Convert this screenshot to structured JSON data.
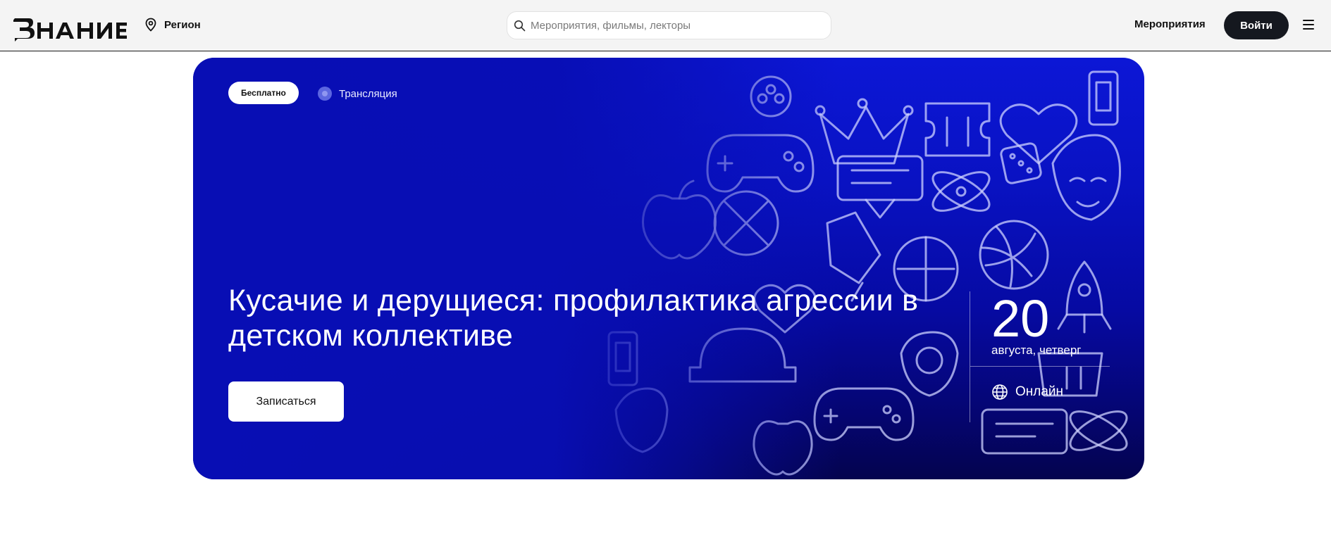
{
  "header": {
    "logo_text": "ЗНАНИЕ",
    "region_label": "Регион",
    "search_placeholder": "Мероприятия, фильмы, лекторы",
    "nav_events": "Мероприятия",
    "login_label": "Войти"
  },
  "event": {
    "badge_price": "Бесплатно",
    "badge_format": "Трансляция",
    "title": "Кусачие и дерущиеся: профилактика агрессии в детском коллективе",
    "signup_label": "Записаться",
    "date_day": "20",
    "date_sub": "августа, четверг",
    "location": "Онлайн"
  },
  "colors": {
    "accent_loadbar": "#f6c800",
    "hero_blue": "#0912c2",
    "login_bg": "#15181f"
  },
  "icons": [
    "location-pin-icon",
    "search-icon",
    "menu-icon",
    "globe-icon"
  ]
}
